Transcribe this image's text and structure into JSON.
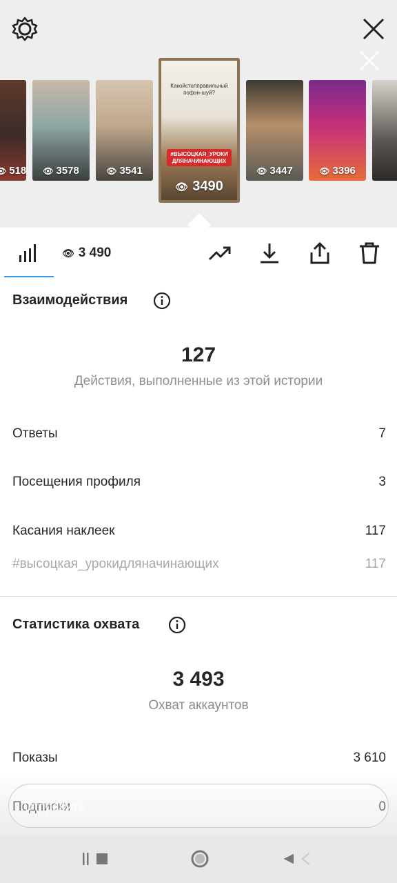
{
  "stories": [
    {
      "views": "518"
    },
    {
      "views": "3578"
    },
    {
      "views": "3541"
    },
    {
      "views": "3490",
      "caption": "Какойстолправильный пофэн-шуй?",
      "tag": "#ВЫСОЦКАЯ_УРОКИ ДЛЯНАЧИНАЮЩИХ"
    },
    {
      "views": "3447"
    },
    {
      "views": "3396"
    }
  ],
  "toolbar": {
    "views": "3 490"
  },
  "interactions": {
    "title": "Взаимодействия",
    "total": "127",
    "subtitle": "Действия, выполненные из этой истории",
    "rows": [
      {
        "label": "Ответы",
        "value": "7"
      },
      {
        "label": "Посещения профиля",
        "value": "3"
      },
      {
        "label": "Касания наклеек",
        "value": "117"
      },
      {
        "label": "#высоцкая_урокидляначинающих",
        "value": "117"
      }
    ]
  },
  "reach": {
    "title": "Статистика охвата",
    "total": "3 493",
    "subtitle": "Охват аккаунтов",
    "rows": [
      {
        "label": "Показы",
        "value": "3 610"
      },
      {
        "label": "Подписки",
        "value": "0"
      }
    ]
  },
  "reply": {
    "placeholder": "Отправить..."
  }
}
